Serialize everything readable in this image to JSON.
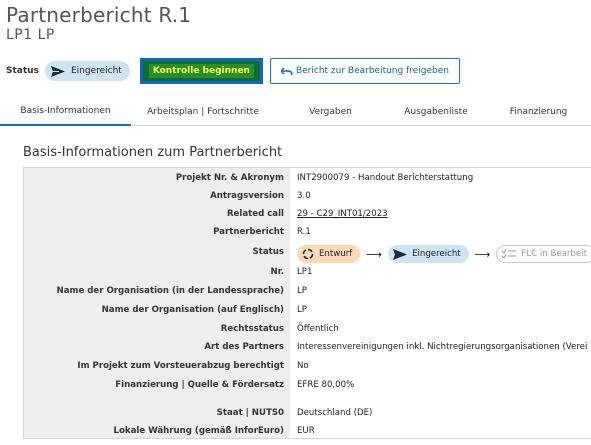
{
  "header": {
    "title": "Partnerbericht R.1",
    "subtitle": "LP1 LP"
  },
  "status_bar": {
    "label": "Status",
    "status": "Eingereicht",
    "primary_button": "Kontrolle beginnen",
    "secondary_button": "Bericht zur Bearbeitung freigeben"
  },
  "tabs": [
    {
      "label": "Basis-Informationen",
      "active": true
    },
    {
      "label": "Arbeitsplan | Fortschritte"
    },
    {
      "label": "Vergaben"
    },
    {
      "label": "Ausgabenliste"
    },
    {
      "label": "Finanzierung"
    }
  ],
  "section": {
    "title": "Basis-Informationen zum Partnerbericht"
  },
  "info": {
    "project_label": "Projekt Nr. & Akronym",
    "project_value": "INT2900079 - Handout Berichterstattung",
    "version_label": "Antragsversion",
    "version_value": "3.0",
    "call_label": "Related call",
    "call_value": "29 - C29_INT01/2023",
    "partner_report_label": "Partnerbericht",
    "partner_report_value": "R.1",
    "status_label": "Status",
    "status_flow": [
      "Entwurf",
      "Eingereicht",
      "FLC in Bearbeit"
    ],
    "nr_label": "Nr.",
    "nr_value": "LP1",
    "org_local_label": "Name der Organisation (in der Landessprache)",
    "org_local_value": "LP",
    "org_en_label": "Name der Organisation (auf Englisch)",
    "org_en_value": "LP",
    "legal_label": "Rechtsstatus",
    "legal_value": "Öffentlich",
    "type_label": "Art des Partners",
    "type_value": "Interessenvereinigungen inkl. Nichtregierungsorganisationen (Verei",
    "vat_label": "Im Projekt zum Vorsteuerabzug berechtigt",
    "vat_value": "No",
    "funding_label": "Finanzierung | Quelle & Fördersatz",
    "funding_value": "EFRE 80,00%",
    "nuts_label": "Staat | NUTS0",
    "nuts_value": "Deutschland (DE)",
    "currency_label": "Lokale Währung (gemäß InforEuro)",
    "currency_value": "EUR"
  }
}
